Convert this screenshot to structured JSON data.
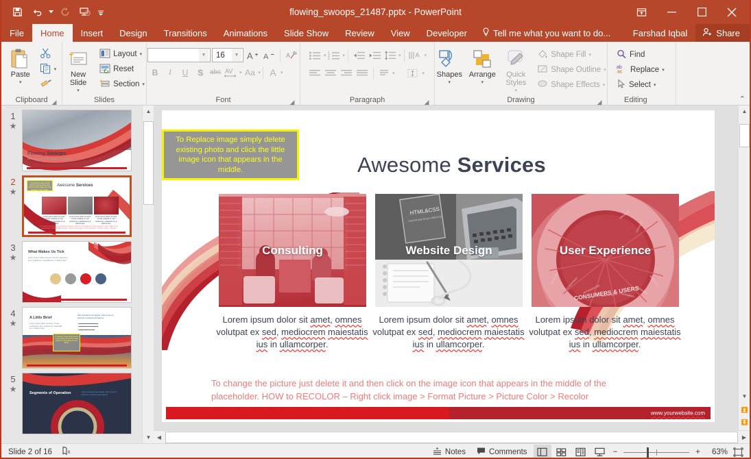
{
  "window": {
    "title": "flowing_swoops_21487.pptx - PowerPoint",
    "quick_access": [
      {
        "name": "save-icon",
        "label": "Save"
      },
      {
        "name": "undo-icon",
        "label": "Undo"
      },
      {
        "name": "redo-icon",
        "label": "Redo"
      },
      {
        "name": "start-presentation-icon",
        "label": "Start From Beginning"
      },
      {
        "name": "customize-qat-icon",
        "label": "Customize Quick Access Toolbar"
      }
    ],
    "controls": [
      {
        "name": "ribbon-display-options-icon",
        "label": "Ribbon Display Options"
      },
      {
        "name": "minimize-icon",
        "label": "Minimize"
      },
      {
        "name": "maximize-icon",
        "label": "Restore Down"
      },
      {
        "name": "close-icon",
        "label": "Close"
      }
    ],
    "accent_color": "#b7472a"
  },
  "tabs": [
    {
      "label": "File",
      "active": false
    },
    {
      "label": "Home",
      "active": true
    },
    {
      "label": "Insert",
      "active": false
    },
    {
      "label": "Design",
      "active": false
    },
    {
      "label": "Transitions",
      "active": false
    },
    {
      "label": "Animations",
      "active": false
    },
    {
      "label": "Slide Show",
      "active": false
    },
    {
      "label": "Review",
      "active": false
    },
    {
      "label": "View",
      "active": false
    },
    {
      "label": "Developer",
      "active": false
    }
  ],
  "tellme": "Tell me what you want to do...",
  "account": {
    "user": "Farshad Iqbal",
    "share_label": "Share"
  },
  "ribbon": {
    "clipboard": {
      "label": "Clipboard",
      "paste": "Paste",
      "cut": "Cut",
      "copy": "Copy",
      "format_painter": "Format Painter"
    },
    "slides": {
      "label": "Slides",
      "new_slide": "New Slide",
      "layout": "Layout",
      "reset": "Reset",
      "section": "Section"
    },
    "font": {
      "label": "Font",
      "font_name": "",
      "font_name_placeholder": "",
      "font_size": "16",
      "increase_size": "Increase Font Size",
      "decrease_size": "Decrease Font Size",
      "clear_formatting": "Clear All Formatting",
      "bold": "B",
      "italic": "I",
      "underline": "U",
      "shadow": "S",
      "strikethrough": "abc",
      "character_spacing": "AV",
      "change_case": "Aa",
      "font_color": "A"
    },
    "paragraph": {
      "label": "Paragraph",
      "bullets": "Bullets",
      "numbering": "Numbering",
      "decrease_indent": "Decrease List Level",
      "increase_indent": "Increase List Level",
      "line_spacing": "Line Spacing",
      "text_direction": "Text Direction",
      "align_text": "Align Text",
      "convert_smartart": "Convert to SmartArt",
      "align_left": "Align Left",
      "align_center": "Center",
      "align_right": "Align Right",
      "justify": "Justify",
      "columns": "Columns"
    },
    "drawing": {
      "label": "Drawing",
      "shapes": "Shapes",
      "arrange": "Arrange",
      "quick_styles": "Quick Styles",
      "shape_fill": "Shape Fill",
      "shape_outline": "Shape Outline",
      "shape_effects": "Shape Effects"
    },
    "editing": {
      "label": "Editing",
      "find": "Find",
      "replace": "Replace",
      "select": "Select",
      "collapse_ribbon": "Collapse the Ribbon"
    }
  },
  "thumbnails": [
    {
      "number": "1",
      "selected": false,
      "title": "Flowing Swoops",
      "subtitle": "An Animated Presentation Template",
      "kind": "title"
    },
    {
      "number": "2",
      "selected": true,
      "title": "Awesome Services",
      "subtitle": "",
      "kind": "services"
    },
    {
      "number": "3",
      "selected": false,
      "title": "What Makes Us Tick",
      "subtitle": "Lorem ipsum dolor sit amet, omnes volutpat ex sed, mediocrem maiestatis ius in ullamcorper.",
      "kind": "tick"
    },
    {
      "number": "4",
      "selected": false,
      "title": "A Little Brief",
      "subtitle": "After animation has played, click mouse to advance remaining animations.",
      "kind": "brief"
    },
    {
      "number": "5",
      "selected": false,
      "title": "Segments of Operation",
      "subtitle": "After animation has played, click mouse to advance remaining animations.",
      "kind": "segments"
    }
  ],
  "slide": {
    "title_light": "Awesome ",
    "title_bold": "Services",
    "callout": "To Replace image simply delete existing photo and click the little image icon that appears in the middle.",
    "cards": [
      {
        "label": "Consulting",
        "caption_l1": "Lorem ipsum dolor sit ",
        "caption_sp1": "amet",
        "caption_l1b": ", ",
        "caption_sp2": "omnes",
        "caption_l2a": "volutpat ex ",
        "caption_sp3": "sed",
        "caption_l2b": ", ",
        "caption_sp4": "mediocrem",
        "caption_sp5": "maiestatis",
        "caption_l3a": " ",
        "caption_sp6": "ius",
        "caption_l3b": " in ",
        "caption_sp7": "ullamcorper",
        "caption_l3c": "."
      },
      {
        "label": "Website Design",
        "caption_l1": "Lorem ipsum dolor sit ",
        "caption_sp1": "amet",
        "caption_l1b": ", ",
        "caption_sp2": "omnes",
        "caption_l2a": "volutpat ex ",
        "caption_sp3": "sed",
        "caption_l2b": ", ",
        "caption_sp4": "mediocrem",
        "caption_sp5": "maiestatis",
        "caption_l3a": " ",
        "caption_sp6": "ius",
        "caption_l3b": " in ",
        "caption_sp7": "ullamcorper",
        "caption_l3c": "."
      },
      {
        "label": "User Experience",
        "caption_l1": "Lorem ipsum dolor sit ",
        "caption_sp1": "amet",
        "caption_l1b": ", ",
        "caption_sp2": "omnes",
        "caption_l2a": "volutpat ex ",
        "caption_sp3": "sed",
        "caption_l2b": ", ",
        "caption_sp4": "mediocrem",
        "caption_sp5": "maiestatis",
        "caption_l3a": " ",
        "caption_sp6": "ius",
        "caption_l3b": " in ",
        "caption_sp7": "ullamcorper",
        "caption_l3c": "."
      }
    ],
    "instruction_line1": "To change the picture just delete it and then click on the image icon that appears in the middle of the",
    "instruction_line2": "placeholder.  HOW to RECOLOR – Right click image  >  Format Picture  >  Picture Color  >  Recolor",
    "footer_site": "www.yourwebsite.com",
    "image_alts": {
      "card1": "two people meeting in office booth, red duotone",
      "card2": "laptop, notebook and HTML & CSS book on desk, grayscale",
      "card3": "circular consumer segmentation diagram, red duotone"
    }
  },
  "status": {
    "slide_indicator": "Slide 2 of 16",
    "language_icon": "spell-check-icon",
    "notes": "Notes",
    "comments": "Comments",
    "views": [
      {
        "name": "normal-view-button",
        "label": "Normal",
        "active": true
      },
      {
        "name": "slide-sorter-button",
        "label": "Slide Sorter",
        "active": false
      },
      {
        "name": "reading-view-button",
        "label": "Reading View",
        "active": false
      },
      {
        "name": "slide-show-button",
        "label": "Slide Show",
        "active": false
      }
    ],
    "zoom_out": "−",
    "zoom_in": "+",
    "zoom_level": "63%",
    "fit_to_window": "Fit slide to current window"
  }
}
